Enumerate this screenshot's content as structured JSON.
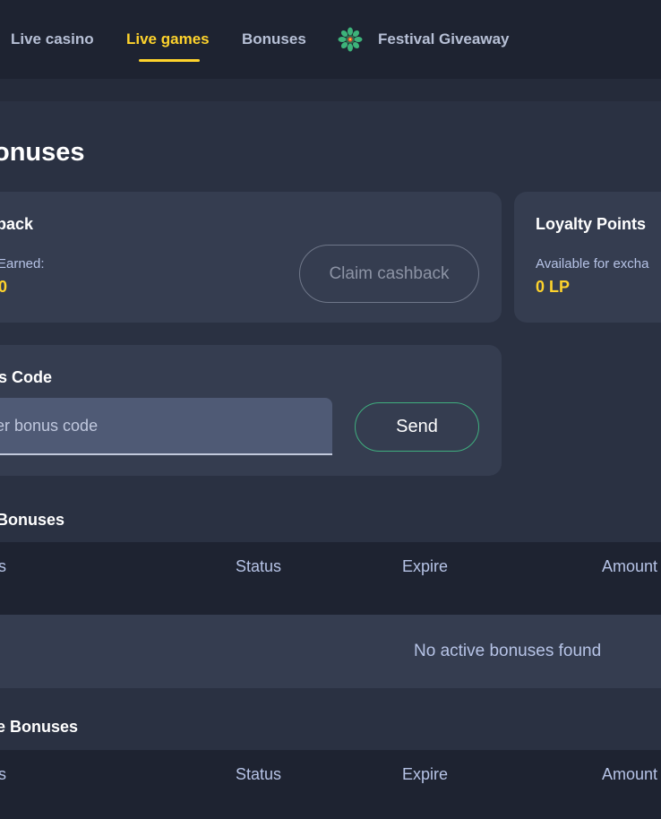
{
  "nav": {
    "items": [
      {
        "label": "Live casino",
        "active": false
      },
      {
        "label": "Live games",
        "active": true
      },
      {
        "label": "Bonuses",
        "active": false
      },
      {
        "label": "Festival Giveaway",
        "active": false,
        "icon": "festival-wreath-icon"
      }
    ],
    "active_color": "#fed32c"
  },
  "page": {
    "title": "onuses"
  },
  "cashback": {
    "title": "back",
    "earned_label": "Earned:",
    "earned_value": "0",
    "claim_label": "Claim cashback"
  },
  "loyalty": {
    "title": "Loyalty Points",
    "available_label": "Available for excha",
    "value": "0 LP"
  },
  "bonus_code": {
    "title": "s Code",
    "placeholder": "ter bonus code",
    "value": "",
    "send_label": "Send"
  },
  "active_bonuses": {
    "title": "Bonuses",
    "columns": [
      "s",
      "Status",
      "Expire",
      "Amount"
    ],
    "empty_text": "No active bonuses found"
  },
  "other_bonuses": {
    "title": "e Bonuses",
    "columns": [
      "s",
      "Status",
      "Expire",
      "Amount"
    ]
  },
  "colors": {
    "accent_yellow": "#fed32c",
    "send_border": "#3fae7e",
    "background": "#252b3a"
  }
}
